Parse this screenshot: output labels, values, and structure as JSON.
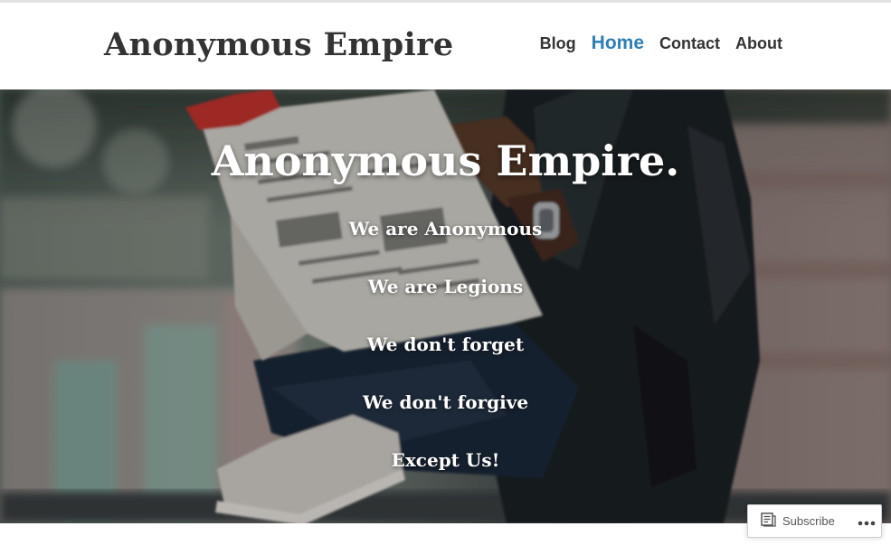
{
  "header": {
    "site_title": "Anonymous Empire",
    "nav": [
      {
        "label": "Blog",
        "current": false
      },
      {
        "label": "Home",
        "current": true
      },
      {
        "label": "Contact",
        "current": false
      },
      {
        "label": "About",
        "current": false
      }
    ]
  },
  "hero": {
    "title": "Anonymous Empire.",
    "lines": [
      "We are Anonymous",
      "We are Legions",
      "We don't forget",
      "We don't forgive",
      "Except Us!"
    ],
    "background_image": "man-in-leather-jacket-reading-newspaper"
  },
  "subscribe_bar": {
    "subscribe_label": "Subscribe",
    "subscribe_icon": "reader-icon",
    "more_icon": "ellipsis-icon"
  },
  "colors": {
    "text_dark": "#333333",
    "nav_current": "#2e7fb4",
    "hero_text": "#ffffff",
    "header_bg": "#ffffff"
  }
}
